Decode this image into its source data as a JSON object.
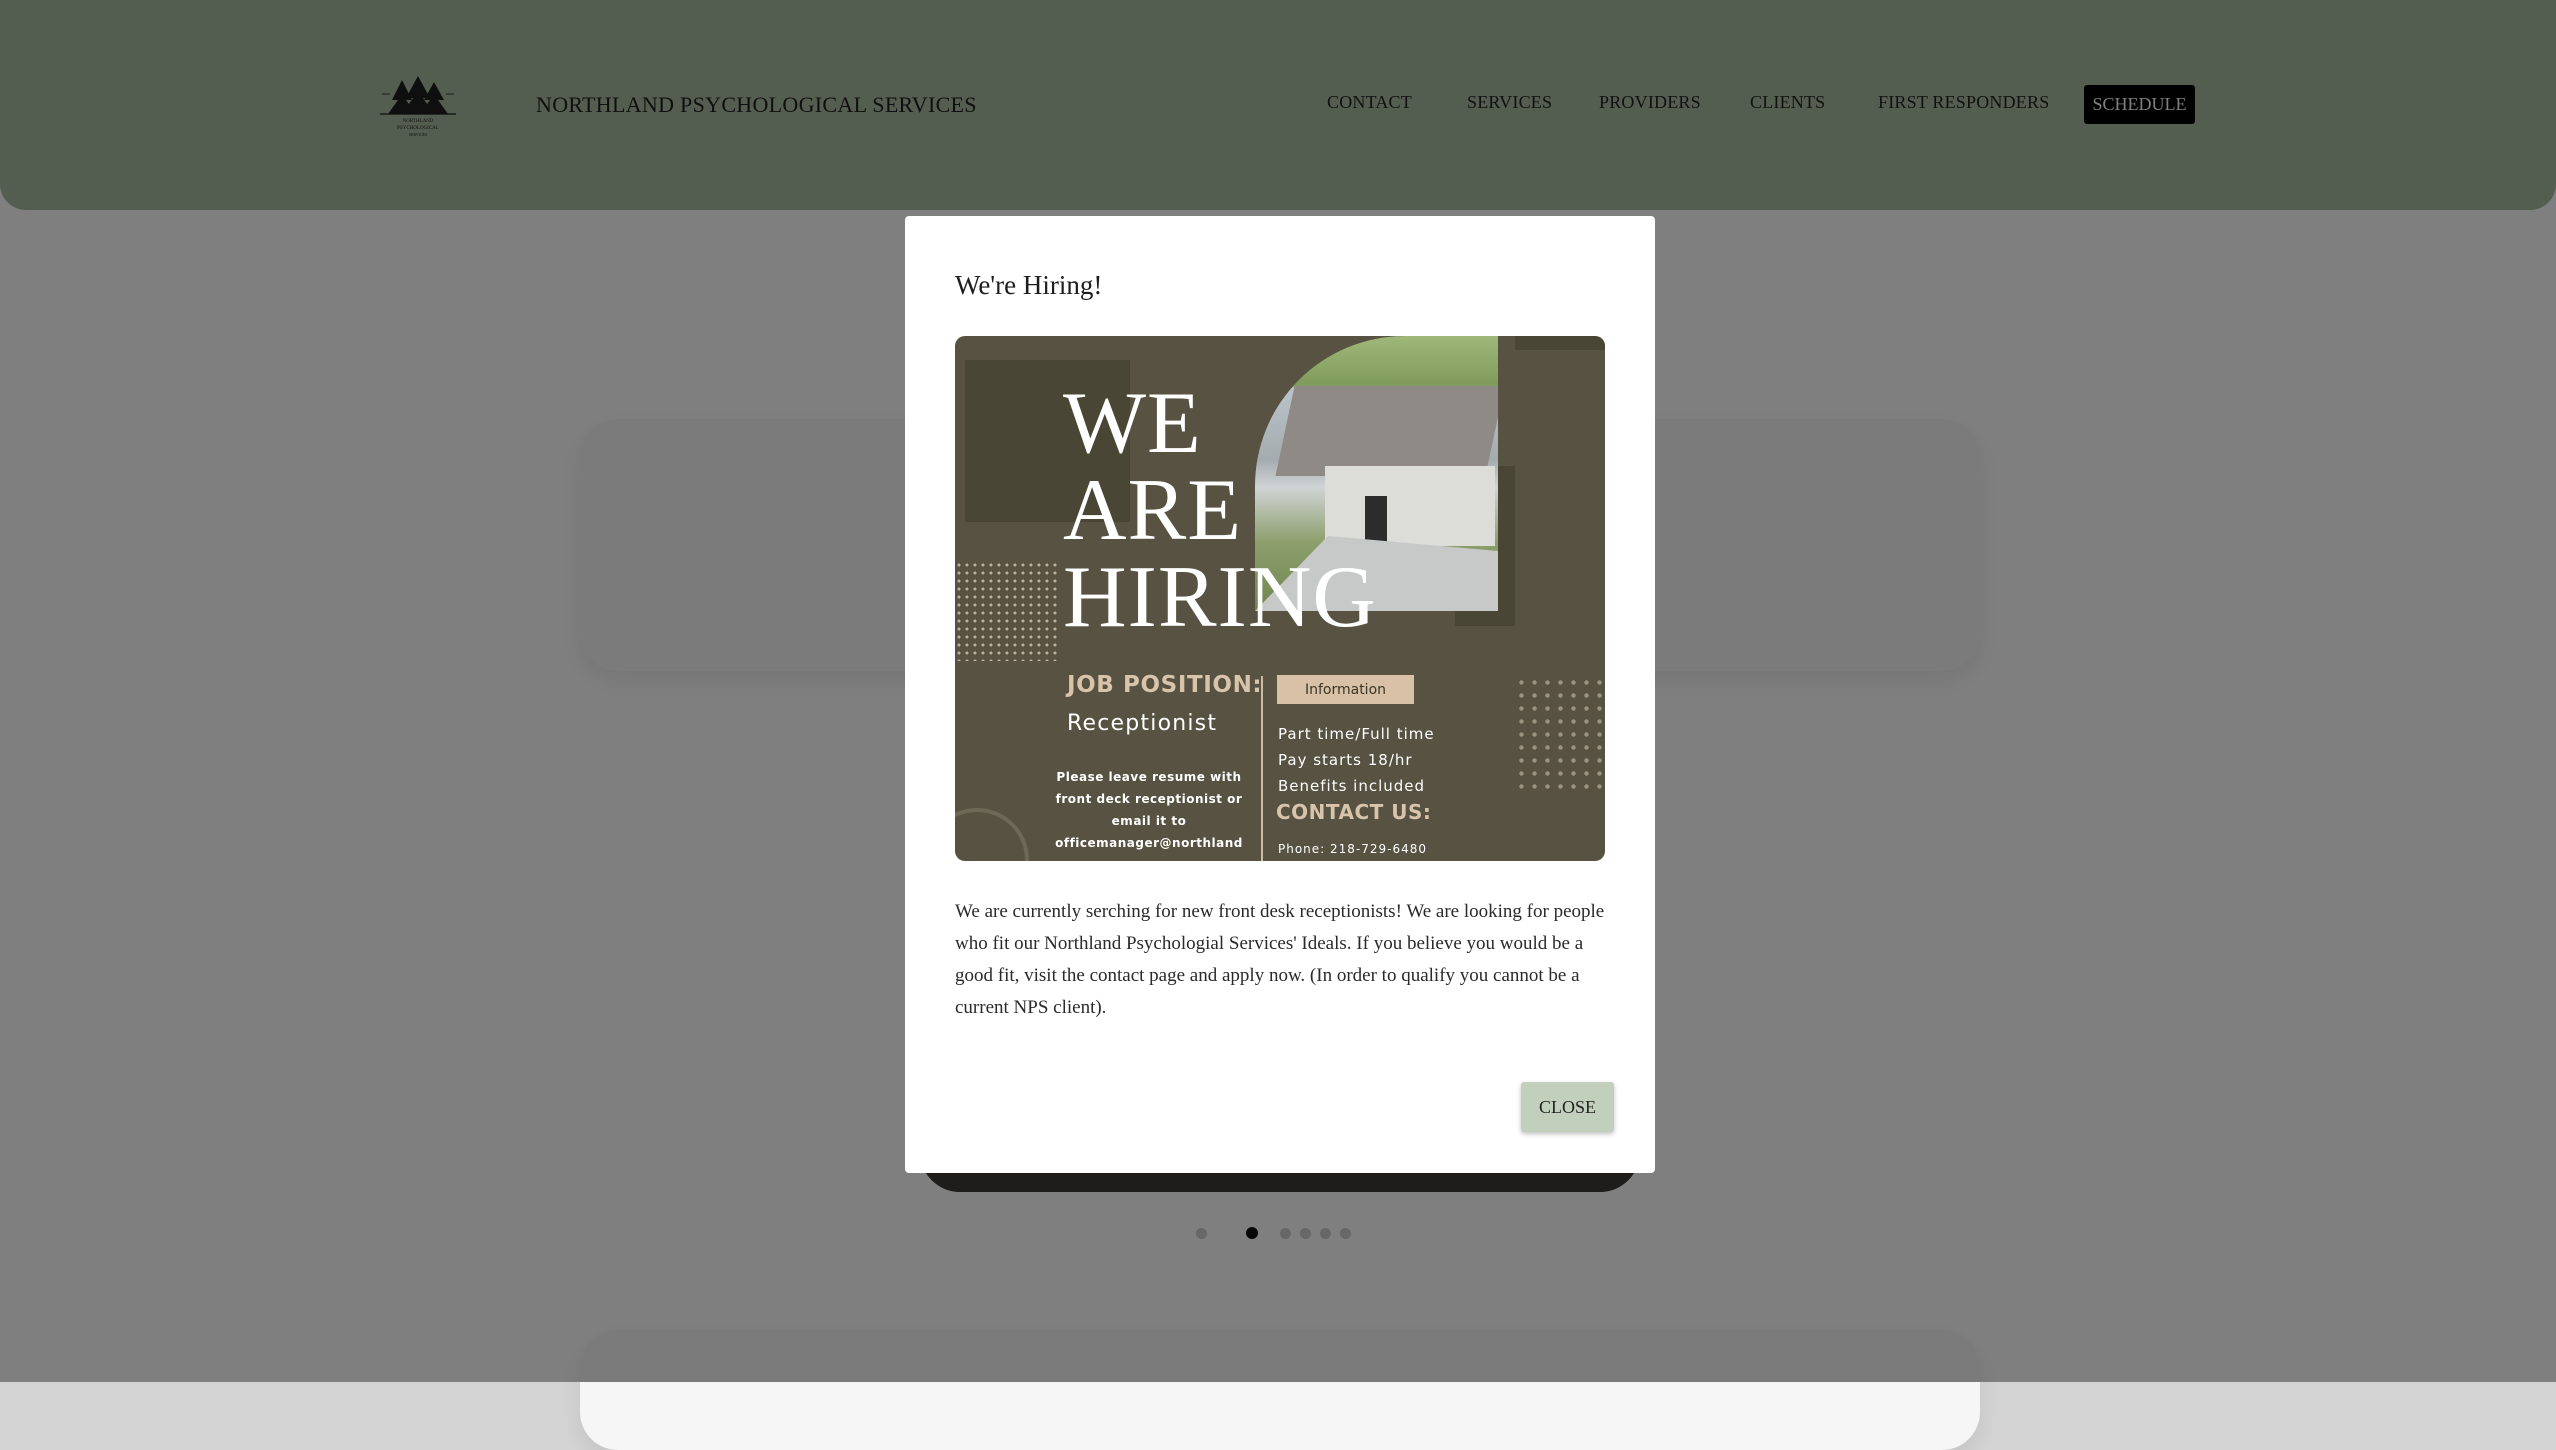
{
  "header": {
    "site_name": "NORTHLAND PSYCHOLOGICAL SERVICES",
    "logo_icon": "pine-trees-logo-icon",
    "logo_text": [
      "NORTHLAND",
      "PSYCHOLOGICAL",
      "SERVICES"
    ]
  },
  "nav": {
    "items": [
      "CONTACT",
      "SERVICES",
      "PROVIDERS",
      "CLIENTS",
      "FIRST RESPONDERS"
    ],
    "schedule": "SCHEDULE"
  },
  "carousel": {
    "dot_count": 6,
    "active_index": 1
  },
  "modal": {
    "title": "We're Hiring!",
    "poster": {
      "headline": [
        "WE",
        "ARE",
        "HIRING"
      ],
      "job_label": "JOB POSITION:",
      "role": "Receptionist",
      "resume_lines": [
        "Please leave resume with",
        "front deck receptionist or",
        "email it to",
        "officemanager@northland"
      ],
      "info_tag": "Information",
      "info_lines": [
        "Part time/Full time",
        "Pay starts 18/hr",
        "Benefits included"
      ],
      "contact_label": "CONTACT US:",
      "phone": "Phone: 218-729-6480"
    },
    "body": "We are currently serching for new front desk receptionists! We are looking for people who fit our Northland Psychologial Services' Ideals. If you believe you would be a good fit, visit the contact page and apply now. (In order to qualify you cannot be a current NPS client).",
    "close_label": "CLOSE"
  },
  "colors": {
    "header_bg": "#a9bca1",
    "poster_bg": "#575241",
    "poster_accent": "#d8c4aa",
    "close_button_bg": "#c2cfbc"
  }
}
